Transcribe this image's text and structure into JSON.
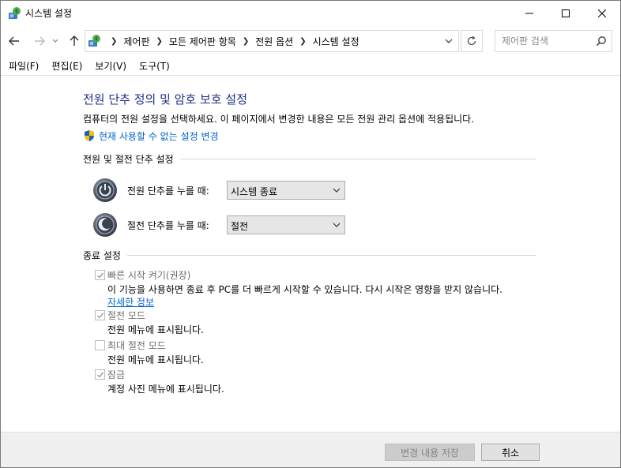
{
  "window": {
    "title": "시스템 설정"
  },
  "nav": {
    "breadcrumbs": [
      "제어판",
      "모든 제어판 항목",
      "전원 옵션",
      "시스템 설정"
    ],
    "search_placeholder": "제어판 검색"
  },
  "menu": {
    "items": [
      "파일(F)",
      "편집(E)",
      "보기(V)",
      "도구(T)"
    ]
  },
  "main": {
    "title": "전원 단추 정의 및 암호 보호 설정",
    "description": "컴퓨터의 전원 설정을 선택하세요. 이 페이지에서 변경한 내용은 모든 전원 관리 옵션에 적용됩니다.",
    "change_link": "현재 사용할 수 없는 설정 변경"
  },
  "power_section": {
    "title": "전원 및 절전 단추 설정",
    "power_button": {
      "label": "전원 단추를 누를 때:",
      "value": "시스템 종료"
    },
    "sleep_button": {
      "label": "절전 단추를 누를 때:",
      "value": "절전"
    }
  },
  "shutdown_section": {
    "title": "종료 설정",
    "options": [
      {
        "label": "빠른 시작 켜기(권장)",
        "checked": true,
        "description": "이 기능을 사용하면 종료 후 PC를 더 빠르게 시작할 수 있습니다. 다시 시작은 영향을 받지 않습니다.",
        "link": "자세한 정보"
      },
      {
        "label": "절전 모드",
        "checked": true,
        "description": "전원 메뉴에 표시됩니다."
      },
      {
        "label": "최대 절전 모드",
        "checked": false,
        "description": "전원 메뉴에 표시됩니다."
      },
      {
        "label": "잠금",
        "checked": true,
        "description": "계정 사진 메뉴에 표시됩니다."
      }
    ]
  },
  "footer": {
    "save_label": "변경 내용 저장",
    "cancel_label": "취소"
  },
  "colors": {
    "heading": "#1e3287",
    "link": "#0066cc",
    "disabled_text": "#6d6d6d"
  }
}
